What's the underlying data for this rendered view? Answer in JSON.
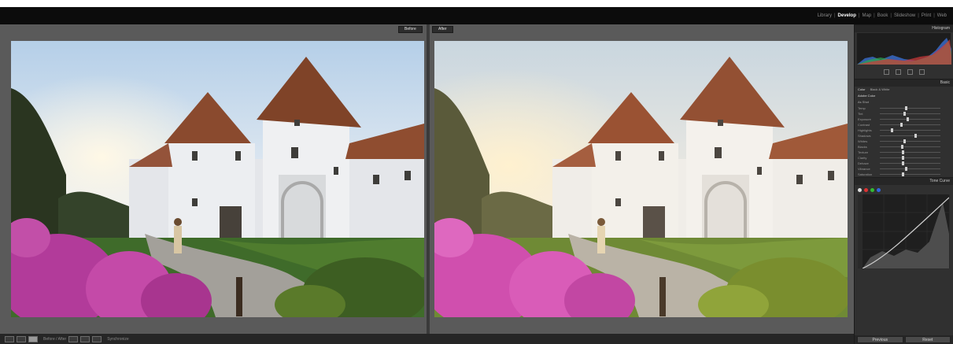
{
  "modules": {
    "items": [
      {
        "label": "Library",
        "active": false
      },
      {
        "label": "Develop",
        "active": true
      },
      {
        "label": "Map",
        "active": false
      },
      {
        "label": "Book",
        "active": false
      },
      {
        "label": "Slideshow",
        "active": false
      },
      {
        "label": "Print",
        "active": false
      },
      {
        "label": "Web",
        "active": false
      }
    ]
  },
  "compare": {
    "before_label": "Before",
    "after_label": "After"
  },
  "toolbar": {
    "compare_mode_label": "Before / After",
    "sync_label": "Synchronize"
  },
  "panel": {
    "histogram_title": "Histogram",
    "basic_title": "Basic",
    "tone_curve_title": "Tone Curve",
    "profile_label": "Adobe Color",
    "wb_label": "As Shot",
    "treatment_color": "Color",
    "treatment_bw": "Black & White",
    "rows": [
      {
        "label": "Temp",
        "knob": 0.55
      },
      {
        "label": "Tint",
        "knob": 0.52
      },
      {
        "label": "Exposure",
        "knob": 0.58
      },
      {
        "label": "Contrast",
        "knob": 0.45
      },
      {
        "label": "Highlights",
        "knob": 0.3
      },
      {
        "label": "Shadows",
        "knob": 0.7
      },
      {
        "label": "Whites",
        "knob": 0.52
      },
      {
        "label": "Blacks",
        "knob": 0.48
      },
      {
        "label": "Texture",
        "knob": 0.5
      },
      {
        "label": "Clarity",
        "knob": 0.5
      },
      {
        "label": "Dehaze",
        "knob": 0.5
      },
      {
        "label": "Vibrance",
        "knob": 0.55
      },
      {
        "label": "Saturation",
        "knob": 0.5
      }
    ],
    "previous_button": "Previous",
    "reset_button": "Reset"
  },
  "colors": {
    "accent": "#ffffff",
    "panel_bg": "#303030",
    "compare_bg": "#5a5a5a"
  }
}
